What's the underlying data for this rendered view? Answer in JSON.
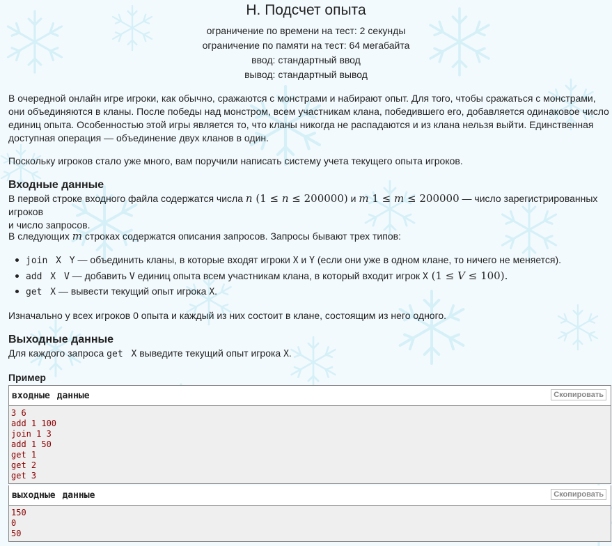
{
  "problem": {
    "title": "H. Подсчет опыта",
    "time_limit": "ограничение по времени на тест: 2 секунды",
    "memory_limit": "ограничение по памяти на тест: 64 мегабайта",
    "input": "ввод: стандартный ввод",
    "output": "вывод: стандартный вывод"
  },
  "statement": {
    "p1": "В очередной онлайн игре игроки, как обычно, сражаются с монстрами и набирают опыт. Для того, чтобы сражаться с монстрами, они объединяются в кланы. После победы над монстром, всем участникам клана, победившего его, добавляется одинаковое число единиц опыта. Особенностью этой игры является то, что кланы никогда не распадаются и из клана нельзя выйти. Единственная доступная операция — объединение двух кланов в один.",
    "p2": "Поскольку игроков стало уже много, вам поручили написать систему учета текущего опыта игроков."
  },
  "input_section": {
    "title": "Входные данные",
    "line1_a": "В первой строке входного файла содержатся числа ",
    "n": "n",
    "n_range_open": " (1 ≤ ",
    "n_var": "n",
    "n_range_close": " ≤ 200000)",
    "and": " и ",
    "m": "m",
    "m_range_open": " 1 ≤ ",
    "m_var": "m",
    "m_range_close": " ≤ 200000",
    "line1_b": " — число зарегистрированных игроков",
    "line2": "и число запросов.",
    "next_a": "В следующих ",
    "next_m": "m",
    "next_b": " строках содержатся описания запросов. Запросы бывают трех типов:",
    "q1_code": "join X Y",
    "q1_a": " — объединить кланы, в которые входят игроки ",
    "q1_x": "X",
    "q1_and": " и ",
    "q1_y": "Y",
    "q1_b": " (если они уже в одном клане, то ничего не меняется).",
    "q2_code": "add X V",
    "q2_a": " — добавить ",
    "q2_v": "V",
    "q2_b": " единиц опыта всем участникам клана, в который входит игрок ",
    "q2_x": "X",
    "q2_range_open": " (1 ≤ ",
    "q2_var": "V",
    "q2_range_close": " ≤ 100).",
    "q3_code": "get X",
    "q3_a": " — вывести текущий опыт игрока ",
    "q3_x": "X",
    "q3_b": ".",
    "initial": "Изначально у всех игроков 0 опыта и каждый из них состоит в клане, состоящим из него одного."
  },
  "output_section": {
    "title": "Выходные данные",
    "line_a": "Для каждого запроса ",
    "code": "get X",
    "line_b": " выведите текущий опыт игрока ",
    "x": "X",
    "line_c": "."
  },
  "example": {
    "title": "Пример",
    "input_label": "входные данные",
    "output_label": "выходные данные",
    "copy_label": "Скопировать",
    "input_lines": [
      "3 6",
      "add 1 100",
      "join 1 3",
      "add 1 50",
      "get 1",
      "get 2",
      "get 3"
    ],
    "output_lines": [
      "150",
      "0",
      "50"
    ]
  }
}
